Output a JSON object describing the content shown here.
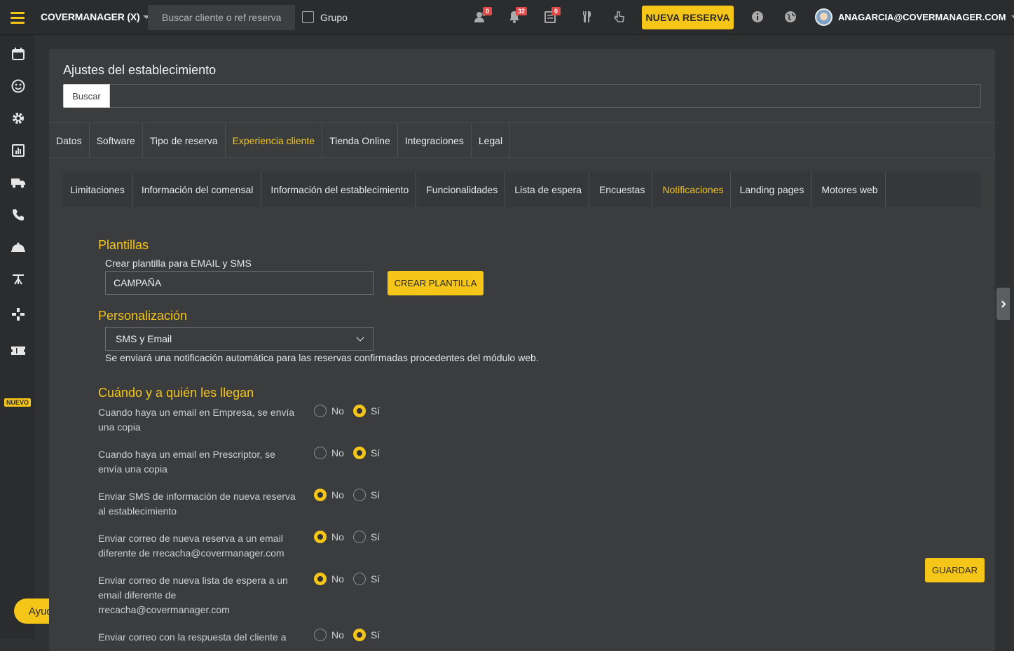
{
  "topbar": {
    "brand": "COVERMANAGER (X)",
    "search_placeholder": "Buscar cliente o ref reserva",
    "grupo_label": "Grupo",
    "badges": [
      "0",
      "32",
      "0"
    ],
    "nueva_reserva": "NUEVA RESERVA",
    "user": "ANAGARCIA@COVERMANAGER.COM"
  },
  "sidebar": {
    "nuevo_badge": "NUEVO",
    "ayuda": "Ayuda"
  },
  "page": {
    "title": "Ajustes del establecimiento",
    "search_button": "Buscar",
    "tabs_main": [
      "Datos",
      "Software",
      "Tipo de reserva",
      "Experiencia cliente",
      "Tienda Online",
      "Integraciones",
      "Legal"
    ],
    "tabs_sub": [
      "Limitaciones",
      "Información del comensal",
      "Información del establecimiento",
      "Funcionalidades",
      "Lista de espera",
      "Encuestas",
      "Notificaciones",
      "Landing pages",
      "Motores web"
    ]
  },
  "plantillas": {
    "title": "Plantillas",
    "label": "Crear plantilla para EMAIL y SMS",
    "input_value": "CAMPAÑA",
    "button": "CREAR PLANTILLA"
  },
  "personalizacion": {
    "title": "Personalización",
    "selected": "SMS y Email",
    "note": "Se enviará una notificación automática para las reservas confirmadas procedentes del módulo web."
  },
  "cuando": {
    "title": "Cuándo y a quién les llegan",
    "no_label": "No",
    "si_label": "Sí",
    "questions": [
      {
        "text": "Cuando haya un email en Empresa, se envía una copia",
        "value": "Sí"
      },
      {
        "text": "Cuando haya un email en Prescriptor, se envía una copia",
        "value": "Sí"
      },
      {
        "text": "Enviar SMS de información de nueva reserva al establecimiento",
        "value": "No"
      },
      {
        "text": "Enviar correo de nueva reserva a un email diferente de rrecacha@covermanager.com",
        "value": "No"
      },
      {
        "text": "Enviar correo de nueva lista de espera a un email diferente de rrecacha@covermanager.com",
        "value": "No"
      },
      {
        "text": "Enviar correo con la respuesta del cliente a",
        "value": "Sí"
      }
    ]
  },
  "actions": {
    "guardar": "GUARDAR"
  }
}
